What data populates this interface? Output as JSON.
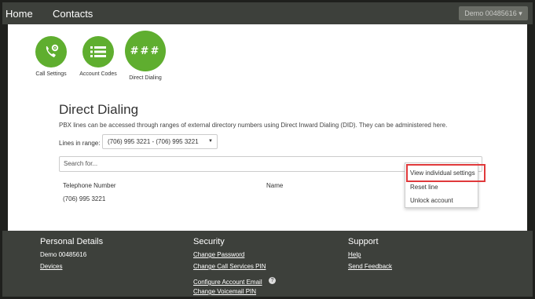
{
  "nav": {
    "home": "Home",
    "contacts": "Contacts",
    "account": "Demo 00485616 ▾"
  },
  "tiles": [
    {
      "label": "Call Settings",
      "icon": "phone-gear-icon"
    },
    {
      "label": "Account Codes",
      "icon": "list-icon"
    },
    {
      "label": "Direct Dialing",
      "icon": "hash-icon"
    }
  ],
  "page": {
    "title": "Direct Dialing",
    "description": "PBX lines can be accessed through ranges of external directory numbers using Direct Inward Dialing (DID). They can be administered here.",
    "lines_label": "Lines in range:",
    "range_value": "(706) 995 3221 - (706) 995 3221",
    "search_placeholder": "Search for..."
  },
  "table": {
    "headers": [
      "Telephone Number",
      "Name"
    ],
    "rows": [
      {
        "phone": "(706) 995 3221",
        "name": ""
      }
    ]
  },
  "context_menu": [
    "View individual settings",
    "Reset line",
    "Unlock account"
  ],
  "footer": {
    "personal": {
      "heading": "Personal Details",
      "name": "Demo 00485616",
      "devices": "Devices"
    },
    "security": {
      "heading": "Security",
      "links": [
        "Change Password",
        "Change Call Services PIN",
        "Configure Account Email",
        "Change Voicemail PIN"
      ]
    },
    "support": {
      "heading": "Support",
      "links": [
        "Help",
        "Send Feedback"
      ]
    }
  },
  "colors": {
    "accent": "#5fae2f",
    "highlight": "#e0393b",
    "bar": "#3d403b"
  }
}
